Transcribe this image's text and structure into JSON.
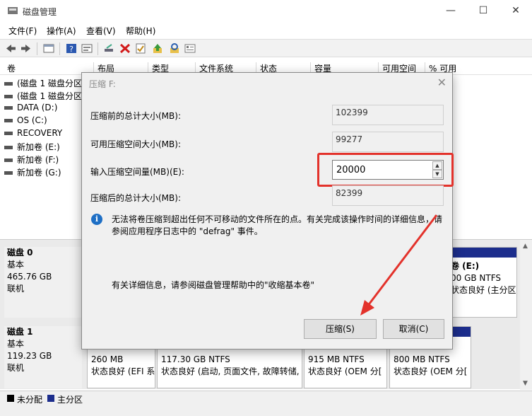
{
  "window": {
    "title": "磁盘管理",
    "minimize": "—",
    "maximize": "☐",
    "close": "✕"
  },
  "menu": [
    "文件(F)",
    "操作(A)",
    "查看(V)",
    "帮助(H)"
  ],
  "columns": [
    "卷",
    "布局",
    "类型",
    "文件系统",
    "状态",
    "容量",
    "可用空间",
    "% 可用"
  ],
  "volumes": [
    "(磁盘 1 磁盘分区",
    "(磁盘 1 磁盘分区",
    "DATA (D:)",
    "OS (C:)",
    "RECOVERY",
    "新加卷 (E:)",
    "新加卷 (F:)",
    "新加卷 (G:)"
  ],
  "disks": [
    {
      "name": "磁盘 0",
      "type": "基本",
      "size": "465.76 GB",
      "status": "联机"
    },
    {
      "name": "磁盘 1",
      "type": "基本",
      "size": "119.23 GB",
      "status": "联机"
    }
  ],
  "disk0_partition_right": {
    "name": "卷 (E:)",
    "size": "00 GB NTFS",
    "status": "状态良好 (主分区)"
  },
  "disk1_partitions": [
    {
      "size": "260 MB",
      "status": "状态良好 (EFI 系"
    },
    {
      "size": "117.30 GB NTFS",
      "status": "状态良好 (启动, 页面文件, 故障转储,"
    },
    {
      "size": "915 MB NTFS",
      "status": "状态良好 (OEM 分["
    },
    {
      "size": "800 MB NTFS",
      "status": "状态良好 (OEM 分["
    }
  ],
  "legend": {
    "unallocated": "未分配",
    "primary": "主分区"
  },
  "dialog": {
    "title": "压缩 F:",
    "close": "✕",
    "total_before_label": "压缩前的总计大小(MB):",
    "total_before_value": "102399",
    "available_label": "可用压缩空间大小(MB):",
    "available_value": "99277",
    "input_label": "输入压缩空间量(MB)(E):",
    "input_value": "20000",
    "total_after_label": "压缩后的总计大小(MB):",
    "total_after_value": "82399",
    "info_icon": "i",
    "info_text": "无法将卷压缩到超出任何不可移动的文件所在的点。有关完成该操作时间的详细信息，请参阅应用程序日志中的 \"defrag\" 事件。",
    "more_info": "有关详细信息，请参阅磁盘管理帮助中的\"收缩基本卷\"",
    "shrink_button": "压缩(S)",
    "cancel_button": "取消(C)"
  },
  "colors": {
    "highlight": "#e3322b",
    "primary_partition": "#1c2d8c",
    "info_icon": "#1e6fc5"
  },
  "icons": [
    "app-icon",
    "back-icon",
    "forward-icon",
    "console-icon",
    "help-icon",
    "properties-icon",
    "connect-icon",
    "delete-icon",
    "check-icon",
    "up-icon",
    "search-icon",
    "settings-icon",
    "info-icon",
    "spin-up-icon",
    "spin-down-icon"
  ]
}
